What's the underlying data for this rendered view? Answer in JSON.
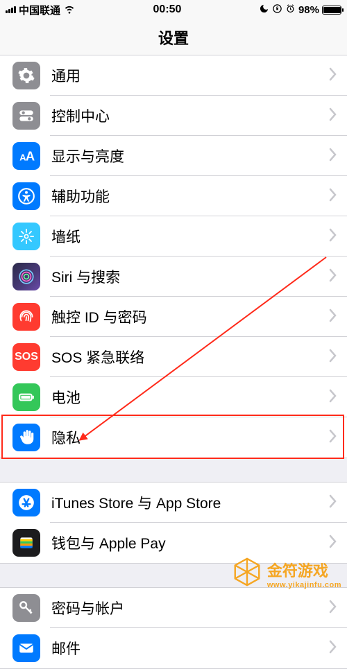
{
  "status": {
    "carrier": "中国联通",
    "time": "00:50",
    "battery_pct": "98%"
  },
  "nav": {
    "title": "设置"
  },
  "groups": [
    {
      "rows": [
        {
          "name": "general",
          "label": "通用",
          "icon": "gear-icon",
          "bg": "bg-gray"
        },
        {
          "name": "control-center",
          "label": "控制中心",
          "icon": "switches-icon",
          "bg": "bg-gray"
        },
        {
          "name": "display",
          "label": "显示与亮度",
          "icon": "text-size-icon",
          "bg": "bg-blue"
        },
        {
          "name": "accessibility",
          "label": "辅助功能",
          "icon": "accessibility-icon",
          "bg": "bg-blue"
        },
        {
          "name": "wallpaper",
          "label": "墙纸",
          "icon": "flower-icon",
          "bg": "bg-cyan"
        },
        {
          "name": "siri",
          "label": "Siri 与搜索",
          "icon": "siri-icon",
          "bg": "bg-siri"
        },
        {
          "name": "touchid",
          "label": "触控 ID 与密码",
          "icon": "fingerprint-icon",
          "bg": "bg-red"
        },
        {
          "name": "sos",
          "label": "SOS 紧急联络",
          "icon": "sos-icon",
          "bg": "bg-red"
        },
        {
          "name": "battery",
          "label": "电池",
          "icon": "battery-icon",
          "bg": "bg-green"
        },
        {
          "name": "privacy",
          "label": "隐私",
          "icon": "hand-icon",
          "bg": "bg-blue"
        }
      ]
    },
    {
      "rows": [
        {
          "name": "itunes-store",
          "label": "iTunes Store 与 App Store",
          "icon": "appstore-icon",
          "bg": "bg-blue"
        },
        {
          "name": "wallet",
          "label": "钱包与 Apple Pay",
          "icon": "wallet-icon",
          "bg": "bg-black"
        }
      ]
    },
    {
      "rows": [
        {
          "name": "passwords",
          "label": "密码与帐户",
          "icon": "key-icon",
          "bg": "bg-gray"
        },
        {
          "name": "mail",
          "label": "邮件",
          "icon": "mail-icon",
          "bg": "bg-blue"
        }
      ]
    }
  ],
  "highlight_row": "privacy",
  "watermark": {
    "title": "金符游戏",
    "sub": "www.yikajinfu.com"
  }
}
